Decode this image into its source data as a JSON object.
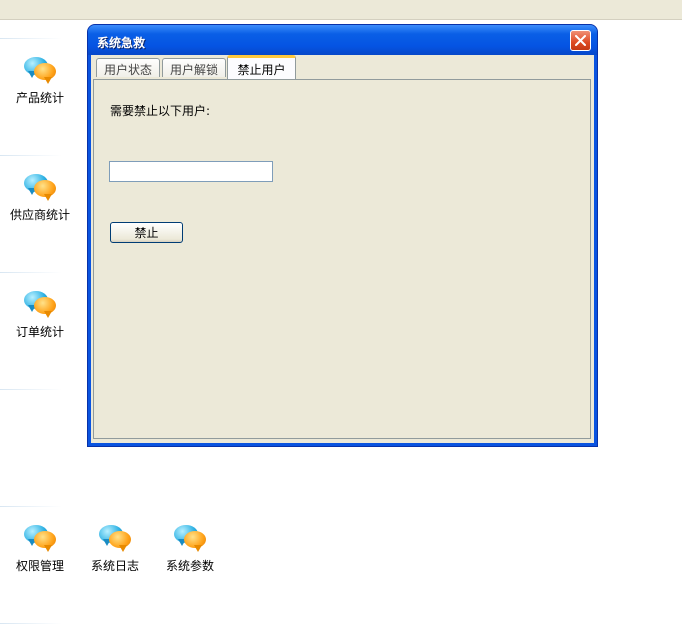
{
  "desktop_icons": [
    {
      "label": "产品统计",
      "icon": "chat-bubbles-icon"
    },
    {
      "label": "供应商统计",
      "icon": "chat-bubbles-icon"
    },
    {
      "label": "订单统计",
      "icon": "chat-bubbles-icon"
    },
    {
      "label": "权限管理",
      "icon": "chat-bubbles-icon"
    },
    {
      "label": "系统日志",
      "icon": "chat-bubbles-icon"
    },
    {
      "label": "系统参数",
      "icon": "chat-bubbles-icon"
    }
  ],
  "dialog": {
    "title": "系统急救",
    "close_icon": "close-icon",
    "tabs": [
      {
        "label": "用户状态",
        "active": false
      },
      {
        "label": "用户解锁",
        "active": false
      },
      {
        "label": "禁止用户",
        "active": true
      }
    ],
    "panel": {
      "prompt": "需要禁止以下用户:",
      "input_value": "",
      "ban_button_label": "禁止"
    }
  },
  "colors": {
    "titlebar": "#0554e3",
    "window_face": "#ece9d8",
    "close_button": "#de4a23",
    "active_tab_highlight": "#ffc83c"
  }
}
